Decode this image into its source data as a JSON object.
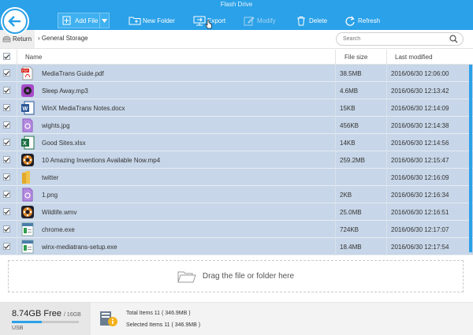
{
  "window": {
    "title": "Flash Drive"
  },
  "toolbar": {
    "add_file": "Add File",
    "new_folder": "New Folder",
    "export": "Export",
    "modify": "Modify",
    "delete": "Delete",
    "refresh": "Refresh"
  },
  "nav": {
    "return_label": "Return",
    "breadcrumb": "General Storage",
    "search_placeholder": "Search"
  },
  "table": {
    "columns": {
      "name": "Name",
      "size": "File size",
      "modified": "Last modified"
    },
    "rows": [
      {
        "name": "MediaTrans  Guide.pdf",
        "size": "38.5MB",
        "modified": "2016/06/30 12:06:00",
        "icon": "pdf-icon"
      },
      {
        "name": "Sleep Away.mp3",
        "size": "4.6MB",
        "modified": "2016/06/30 12:13:42",
        "icon": "audio-icon"
      },
      {
        "name": "WinX MediaTrans Notes.docx",
        "size": "15KB",
        "modified": "2016/06/30 12:14:09",
        "icon": "word-icon"
      },
      {
        "name": "wights.jpg",
        "size": "456KB",
        "modified": "2016/06/30 12:14:38",
        "icon": "image-icon"
      },
      {
        "name": "Good Sites.xlsx",
        "size": "14KB",
        "modified": "2016/06/30 12:14:56",
        "icon": "excel-icon"
      },
      {
        "name": "10 Amazing Inventions Available Now.mp4",
        "size": "259.2MB",
        "modified": "2016/06/30 12:15:47",
        "icon": "video-icon"
      },
      {
        "name": "twitter",
        "size": "",
        "modified": "2016/06/30 12:16:09",
        "icon": "folder-icon"
      },
      {
        "name": "1.png",
        "size": "2KB",
        "modified": "2016/06/30 12:16:34",
        "icon": "image-icon"
      },
      {
        "name": "Wildlife.wmv",
        "size": "25.0MB",
        "modified": "2016/06/30 12:16:51",
        "icon": "video-icon"
      },
      {
        "name": "chrome.exe",
        "size": "724KB",
        "modified": "2016/06/30 12:17:07",
        "icon": "exe-icon"
      },
      {
        "name": "winx-mediatrans-setup.exe",
        "size": "18.4MB",
        "modified": "2016/06/30 12:17:54",
        "icon": "exe-icon"
      }
    ]
  },
  "dropzone": {
    "label": "Drag the file or folder here"
  },
  "footer": {
    "free": "8.74GB Free",
    "total": "/ 16GB",
    "device": "USB",
    "used_fraction": 0.45,
    "total_items": "Total Items 11 ( 346.9MB )",
    "selected_items": "Selected Items 11 ( 346.9MB )"
  },
  "colors": {
    "accent": "#2aa1e8",
    "selected_row": "#c7d6e8"
  }
}
